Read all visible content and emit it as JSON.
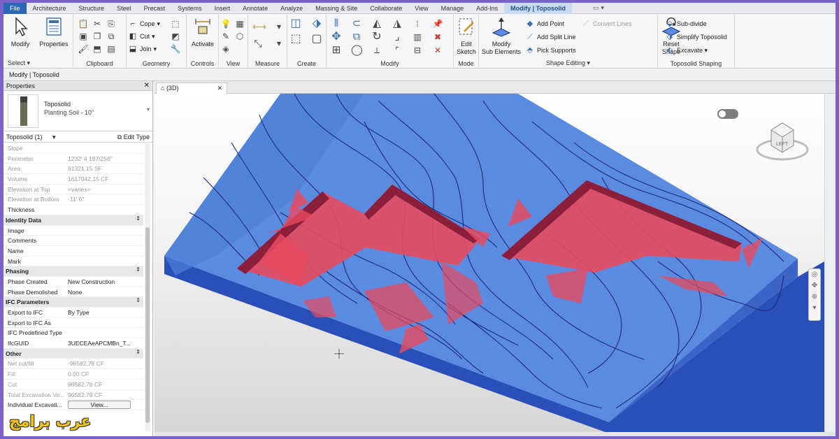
{
  "ribbon_tabs": [
    "File",
    "Architecture",
    "Structure",
    "Steel",
    "Precast",
    "Systems",
    "Insert",
    "Annotate",
    "Analyze",
    "Massing & Site",
    "Collaborate",
    "View",
    "Manage",
    "Add-Ins",
    "Modify | Toposolid"
  ],
  "ribbon": {
    "select": {
      "modify": "Modify",
      "properties": "Properties",
      "select_label": "Select ▾"
    },
    "clipboard": {
      "title": "Clipboard"
    },
    "geometry": {
      "title": "Geometry",
      "cope": "Cope",
      "cut": "Cut",
      "join": "Join"
    },
    "controls": {
      "title": "Controls",
      "activate": "Activate"
    },
    "view": {
      "title": "View"
    },
    "measure": {
      "title": "Measure"
    },
    "create": {
      "title": "Create"
    },
    "modify": {
      "title": "Modify"
    },
    "mode": {
      "title": "Mode",
      "edit_sketch_1": "Edit",
      "edit_sketch_2": "Sketch"
    },
    "shape_editing": {
      "title": "Shape Editing ▾",
      "modify_sub_1": "Modify",
      "modify_sub_2": "Sub Elements",
      "add_point": "Add Point",
      "add_split_line": "Add Split Line",
      "pick_supports": "Pick Supports",
      "convert_lines": "Convert Lines"
    },
    "toposolid_shaping": {
      "title": "Toposolid Shaping",
      "reset_1": "Reset",
      "reset_2": "Shape",
      "subdivide": "Sub-divide",
      "simplify": "Simplify Toposolid",
      "excavate": "Excavate ▾"
    }
  },
  "context_bar": "Modify | Toposolid",
  "properties": {
    "title": "Properties",
    "type_family": "Toposolid",
    "type_name": "Planting Soil - 10\"",
    "instance_filter": "Toposolid (1)",
    "edit_type": "Edit Type",
    "rows": [
      {
        "k": "Slope",
        "v": "",
        "kind": "dim"
      },
      {
        "k": "Perimeter",
        "v": "1232'  4 187/256\"",
        "kind": "dim"
      },
      {
        "k": "Area",
        "v": "91321.15 SF",
        "kind": "dim"
      },
      {
        "k": "Volume",
        "v": "1617042.15 CF",
        "kind": "dim"
      },
      {
        "k": "Elevation at Top",
        "v": "<varies>",
        "kind": "dim"
      },
      {
        "k": "Elevation at Bottom",
        "v": "-11'  6\"",
        "kind": "dim"
      },
      {
        "k": "Thickness",
        "v": "",
        "kind": "val"
      },
      {
        "k": "Identity Data",
        "v": "",
        "kind": "sec"
      },
      {
        "k": "Image",
        "v": "",
        "kind": "val"
      },
      {
        "k": "Comments",
        "v": "",
        "kind": "val"
      },
      {
        "k": "Name",
        "v": "",
        "kind": "val"
      },
      {
        "k": "Mark",
        "v": "",
        "kind": "val"
      },
      {
        "k": "Phasing",
        "v": "",
        "kind": "sec"
      },
      {
        "k": "Phase Created",
        "v": "New Construction",
        "kind": "val"
      },
      {
        "k": "Phase Demolished",
        "v": "None",
        "kind": "val"
      },
      {
        "k": "IFC Parameters",
        "v": "",
        "kind": "sec"
      },
      {
        "k": "Export to IFC",
        "v": "By Type",
        "kind": "val"
      },
      {
        "k": "Export to IFC As",
        "v": "",
        "kind": "val"
      },
      {
        "k": "IFC Predefined Type",
        "v": "",
        "kind": "val"
      },
      {
        "k": "IfcGUID",
        "v": "3UECEAeAPCMBn_T...",
        "kind": "val"
      },
      {
        "k": "Other",
        "v": "",
        "kind": "sec"
      },
      {
        "k": "Net cut/fill",
        "v": "-96582.78 CF",
        "kind": "dim"
      },
      {
        "k": "Fill",
        "v": "0.00 CF",
        "kind": "dim"
      },
      {
        "k": "Cut",
        "v": "96582.78 CF",
        "kind": "dim"
      },
      {
        "k": "Total Excavation Vo...",
        "v": "96582.78 CF",
        "kind": "dim"
      },
      {
        "k": "Individual Excavati...",
        "v": "View...",
        "kind": "button"
      }
    ]
  },
  "view_tab": {
    "label": "(3D)"
  },
  "viewcube_face": "LEFT",
  "watermark": "عرب برامج",
  "colors": {
    "terrain": "#5b8be0",
    "excavation": "#e84a5f",
    "contour": "#1c2a78",
    "ribbon_tab_active": "#2b67b8"
  }
}
